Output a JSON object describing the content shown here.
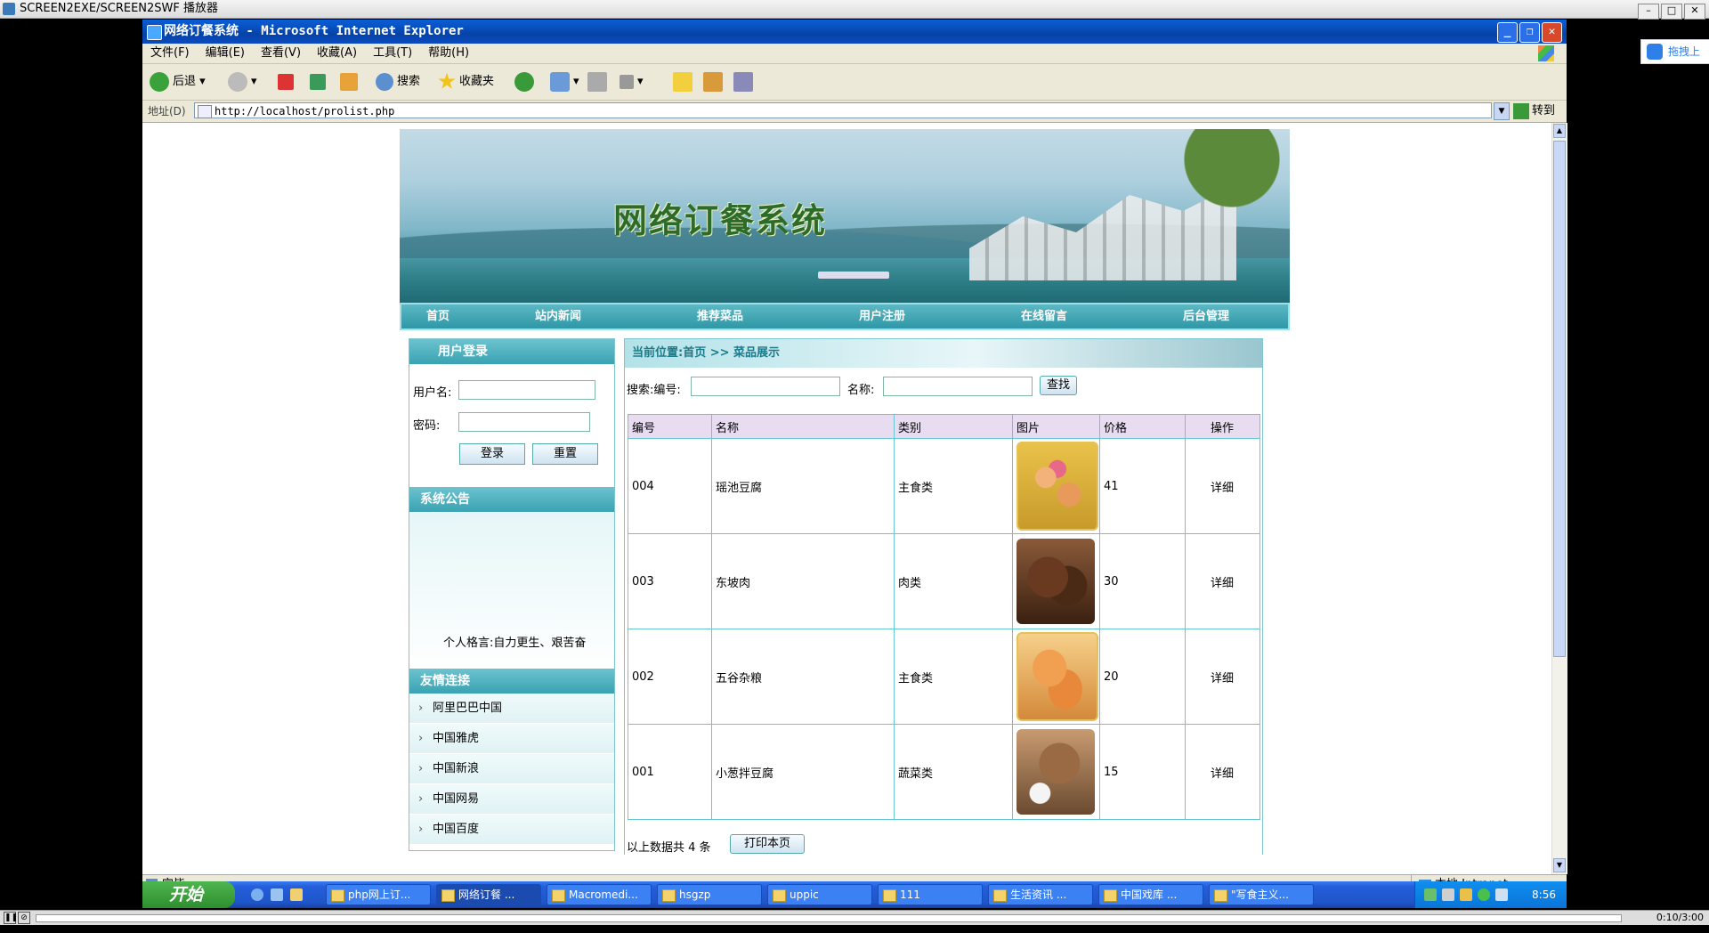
{
  "player": {
    "title": "SCREEN2EXE/SCREEN2SWF 播放器",
    "time": "0:10/3:00"
  },
  "baidu_widget": {
    "label": "拖拽上"
  },
  "browser": {
    "title": "网络订餐系统 - Microsoft Internet Explorer",
    "menu": [
      "文件(F)",
      "编辑(E)",
      "查看(V)",
      "收藏(A)",
      "工具(T)",
      "帮助(H)"
    ],
    "toolbar": {
      "back": "后退",
      "search": "搜索",
      "favorites": "收藏夹"
    },
    "address_label": "地址(D)",
    "url": "http://localhost/prolist.php",
    "go": "转到",
    "status": "完毕",
    "zone": "本地 Intranet"
  },
  "site": {
    "title": "网络订餐系统",
    "nav": [
      "首页",
      "站内新闻",
      "推荐菜品",
      "用户注册",
      "在线留言",
      "后台管理"
    ],
    "login": {
      "title": "用户登录",
      "username_label": "用户名:",
      "password_label": "密码:",
      "login_button": "登录",
      "reset_button": "重置"
    },
    "notice": {
      "title": "系统公告",
      "motto": "个人格言:自力更生、艰苦奋"
    },
    "links": {
      "title": "友情连接",
      "items": [
        "阿里巴巴中国",
        "中国雅虎",
        "中国新浪",
        "中国网易",
        "中国百度"
      ]
    },
    "main": {
      "breadcrumb": "当前位置:首页 >> 菜品展示",
      "search_label": "搜索:编号:",
      "name_label": "名称:",
      "search_button": "查找",
      "columns": [
        "编号",
        "名称",
        "类别",
        "图片",
        "价格",
        "操作"
      ],
      "rows": [
        {
          "id": "004",
          "name": "瑶池豆腐",
          "category": "主食类",
          "price": "41",
          "action": "详细"
        },
        {
          "id": "003",
          "name": "东坡肉",
          "category": "肉类",
          "price": "30",
          "action": "详细"
        },
        {
          "id": "002",
          "name": "五谷杂粮",
          "category": "主食类",
          "price": "20",
          "action": "详细"
        },
        {
          "id": "001",
          "name": "小葱拌豆腐",
          "category": "蔬菜类",
          "price": "15",
          "action": "详细"
        }
      ],
      "total_text": "以上数据共 4 条",
      "print_button": "打印本页"
    }
  },
  "taskbar": {
    "start": "开始",
    "tasks": [
      "php网上订...",
      "网络订餐 ...",
      "Macromedi...",
      "hsgzp",
      "uppic",
      "111",
      "生活资讯 ...",
      "中国戏库 ...",
      "\"写食主义..."
    ],
    "clock": "8:56"
  }
}
